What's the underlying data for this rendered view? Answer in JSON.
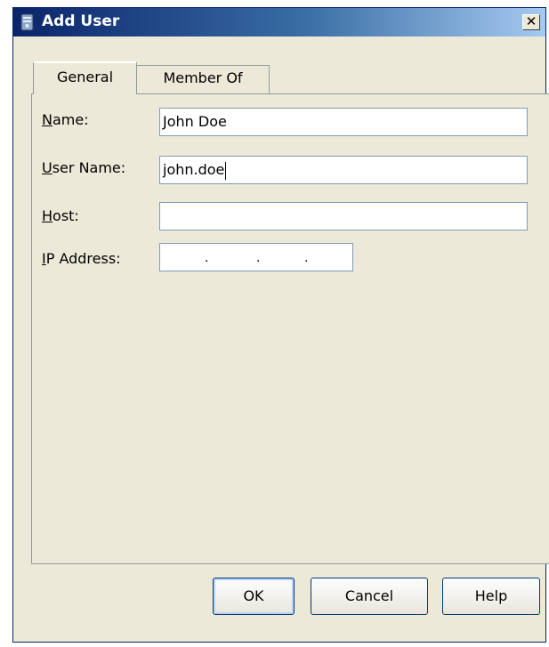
{
  "window": {
    "title": "Add User",
    "close_glyph": "✕",
    "icon": "user-server-icon"
  },
  "tabs": [
    {
      "label": "General",
      "active": true
    },
    {
      "label": "Member Of",
      "active": false
    }
  ],
  "form": {
    "name": {
      "label_mnemonic": "N",
      "label_rest": "ame:",
      "value": "John Doe"
    },
    "user_name": {
      "label_mnemonic": "U",
      "label_rest": "ser Name:",
      "value": "john.doe"
    },
    "host": {
      "label_mnemonic": "H",
      "label_rest": "ost:",
      "value": ""
    },
    "ip_address": {
      "label_mnemonic": "I",
      "label_rest": "P Address:",
      "dot": "."
    }
  },
  "buttons": {
    "ok": "OK",
    "cancel": "Cancel",
    "help": "Help"
  }
}
